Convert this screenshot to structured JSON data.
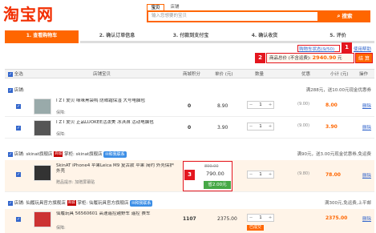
{
  "header": {
    "logo": "淘宝网",
    "search_tabs": [
      "宝贝",
      "店铺"
    ],
    "search_placeholder": "输入您想要的宝贝",
    "search_button": "搜索"
  },
  "steps": [
    {
      "label": "1. 查看购物车",
      "active": true
    },
    {
      "label": "2. 确认订单信息",
      "active": false
    },
    {
      "label": "3. 付款到支付宝",
      "active": false
    },
    {
      "label": "4. 确认收货",
      "active": false
    },
    {
      "label": "5. 评价",
      "active": false
    }
  ],
  "top_links": {
    "cart_status": "购物车状态",
    "cart_count": "(9/50)",
    "help": "使用帮助"
  },
  "annotations": [
    "1",
    "2",
    "3"
  ],
  "summary": {
    "label": "商品总价 (不含运费):",
    "amount": "2940.90",
    "unit": "元",
    "settle": "结 算"
  },
  "table_header": {
    "select_all": "全选",
    "shop": "店铺",
    "item": "店铺宝贝",
    "score": "商城积分",
    "unit_price": "单价 (元)",
    "qty": "数量",
    "promo": "优惠",
    "subtotal": "小计 (元)",
    "action": "操作"
  },
  "shops": [
    {
      "label": "店铺:",
      "name": "",
      "note": "满288元，送10.00元现金优惠券",
      "items": [
        {
          "title": "I Z I 爱贝 咪咪黑袋鸭 防晒霜保湿 大号电脑包",
          "sub": "保障:",
          "score": "0",
          "price": "8.90",
          "qty": "1",
          "promo": "(9.00)",
          "subtotal": "8.00",
          "del": "删除"
        },
        {
          "title": "I Z I 爱贝 正品LUOKEE活泼美 冰淇淋 活动电脑包",
          "sub": "保障:",
          "score": "0",
          "price": "3.90",
          "qty": "1",
          "promo": "(9.00)",
          "subtotal": "3.90",
          "del": "删除"
        }
      ]
    },
    {
      "label": "店铺: skinat旗舰店",
      "tag": "商城",
      "seller": "掌柜: skinat旗舰店",
      "contact": "和我联系",
      "note": "满90元，送3.00元现金优惠券,免运费",
      "items": [
        {
          "title": "SkinAT iPhone4 苹果Leica M9 复古款 苹果 简约 外壳保护 外壳",
          "sub": "赠品提示: 加赠屏幕贴",
          "score": "0",
          "price_old": "899.00",
          "price": "790.00",
          "save": "省2.00元",
          "qty": "1",
          "promo": "(9.80)",
          "subtotal": "78.00",
          "del": "删除"
        }
      ]
    },
    {
      "label": "店铺: 仙履玩具官方旗舰店",
      "tag": "商城",
      "seller": "掌柜: 仙履玩具官方旗舰店",
      "contact": "和我联系",
      "note": "满300元,免运费,上平邮",
      "items": [
        {
          "title": "仙履玩具 56560601 高速遥控越野车 遥控 赛车",
          "sub": "保障:",
          "score": "1107",
          "price": "2375.00",
          "qty": "1",
          "promo": "",
          "subtotal": "2375.00",
          "del": "删除",
          "extra": "已成交"
        }
      ]
    }
  ],
  "colors": {
    "brand": "#f22e00",
    "accent": "#ff6600",
    "highlight": "#e4161e",
    "link": "#3366cc",
    "save": "#46a846"
  }
}
